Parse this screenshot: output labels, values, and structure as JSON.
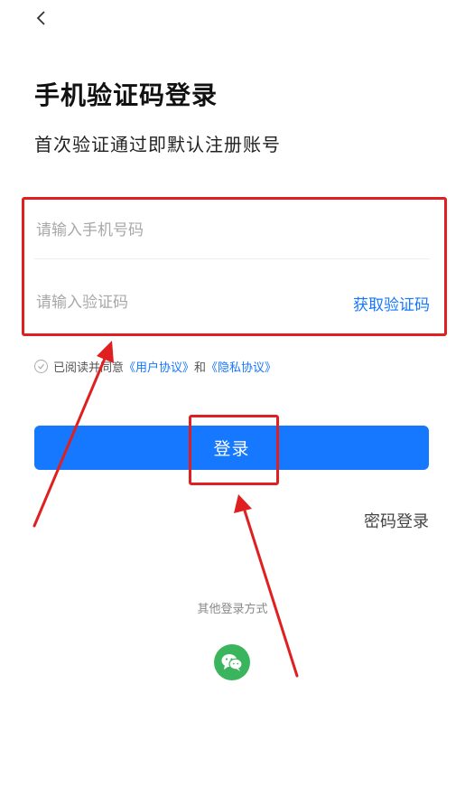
{
  "header": {
    "back_icon": "chevron-left-icon"
  },
  "page": {
    "title": "手机验证码登录",
    "subtitle": "首次验证通过即默认注册账号"
  },
  "form": {
    "phone_placeholder": "请输入手机号码",
    "phone_value": "",
    "code_placeholder": "请输入验证码",
    "code_value": "",
    "get_code_label": "获取验证码"
  },
  "agreement": {
    "prefix": "已阅读并同意",
    "user_agreement": "《用户协议》",
    "and": "和",
    "privacy_agreement": "《隐私协议》",
    "checked": false
  },
  "actions": {
    "login_label": "登录",
    "password_login_label": "密码登录"
  },
  "other_login": {
    "label": "其他登录方式",
    "methods": [
      {
        "icon": "wechat-icon"
      }
    ]
  },
  "colors": {
    "accent": "#1677ff",
    "wechat": "#3bb55d",
    "annotation": "#e02020"
  }
}
